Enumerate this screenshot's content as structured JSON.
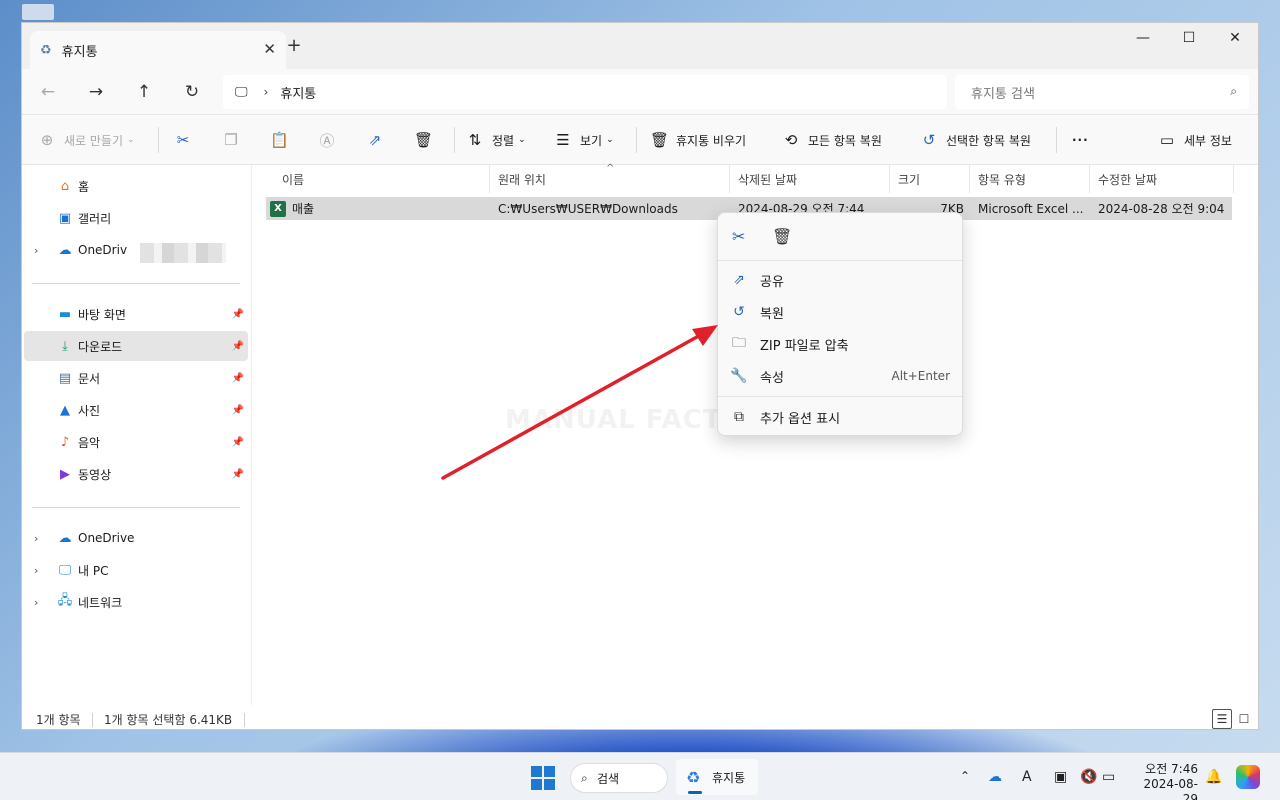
{
  "window": {
    "tab_title": "휴지통",
    "new_tab": "+",
    "close_tab": "✕"
  },
  "address": {
    "path": "휴지통",
    "search_placeholder": "휴지통 검색"
  },
  "toolbar": {
    "new": "새로 만들기",
    "sort": "정렬",
    "view": "보기",
    "empty_bin": "휴지통 비우기",
    "restore_all": "모든 항목 복원",
    "restore_selected": "선택한 항목 복원",
    "more": "···",
    "details": "세부 정보"
  },
  "sidebar": {
    "items": [
      {
        "label": "홈"
      },
      {
        "label": "갤러리"
      },
      {
        "label": "OneDriv"
      },
      {
        "label": "바탕 화면"
      },
      {
        "label": "다운로드"
      },
      {
        "label": "문서"
      },
      {
        "label": "사진"
      },
      {
        "label": "음악"
      },
      {
        "label": "동영상"
      },
      {
        "label": "OneDrive"
      },
      {
        "label": "내 PC"
      },
      {
        "label": "네트워크"
      }
    ]
  },
  "columns": [
    "이름",
    "원래 위치",
    "삭제된 날짜",
    "크기",
    "항목 유형",
    "수정한 날짜"
  ],
  "files": [
    {
      "name": "매출",
      "location": "C:₩Users₩USER₩Downloads",
      "deleted": "2024-08-29 오전 7:44",
      "size": "7KB",
      "type": "Microsoft Excel ...",
      "modified": "2024-08-28 오전 9:04"
    }
  ],
  "context_menu": {
    "share": "공유",
    "restore": "복원",
    "zip": "ZIP 파일로 압축",
    "properties": "속성",
    "properties_shortcut": "Alt+Enter",
    "more_options": "추가 옵션 표시"
  },
  "watermark": "MANUAL FACTORY",
  "status": {
    "count": "1개 항목",
    "selected": "1개 항목 선택함 6.41KB"
  },
  "taskbar": {
    "search": "검색",
    "app": "휴지통",
    "time": "오전 7:46",
    "date": "2024-08-29"
  },
  "colors": {
    "accent": "#0067c0",
    "selection": "#d9d9d9",
    "annotation_arrow": "#e0212b",
    "excel": "#1f7244"
  }
}
